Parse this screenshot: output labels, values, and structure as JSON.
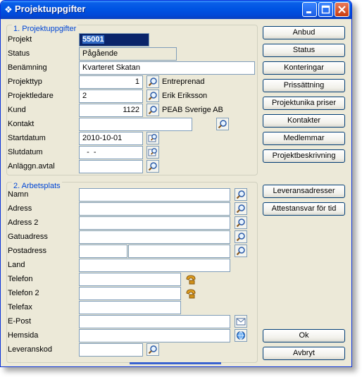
{
  "window": {
    "title": "Projektuppgifter"
  },
  "section1": {
    "title": "1. Projektuppgifter",
    "labels": {
      "projekt": "Projekt",
      "status": "Status",
      "benamning": "Benämning",
      "projekttyp": "Projekttyp",
      "projektledare": "Projektledare",
      "kund": "Kund",
      "kontakt": "Kontakt",
      "startdatum": "Startdatum",
      "slutdatum": "Slutdatum",
      "anlaggn": "Anläggn.avtal"
    },
    "values": {
      "projekt": "55001",
      "status": "Pågående",
      "benamning": "Kvarteret Skatan",
      "projekttyp": "1",
      "projekttyp_name": "Entreprenad",
      "projektledare": "2",
      "projektledare_name": "Erik Eriksson",
      "kund": "1122",
      "kund_name": "PEAB Sverige AB",
      "kontakt": "",
      "startdatum": "2010-10-01",
      "slutdatum": "  -  -",
      "anlaggn": ""
    }
  },
  "section2": {
    "title": "2. Arbetsplats",
    "labels": {
      "namn": "Namn",
      "adress": "Adress",
      "adress2": "Adress 2",
      "gatuadress": "Gatuadress",
      "postadress": "Postadress",
      "land": "Land",
      "telefon": "Telefon",
      "telefon2": "Telefon 2",
      "telefax": "Telefax",
      "epost": "E-Post",
      "hemsida": "Hemsida",
      "leveranskod": "Leveranskod"
    }
  },
  "buttons": {
    "anbud": "Anbud",
    "status": "Status",
    "konteringar": "Konteringar",
    "prissattning": "Prissättning",
    "projektunika": "Projektunika priser",
    "kontakter": "Kontakter",
    "medlemmar": "Medlemmar",
    "projektbeskrivning": "Projektbeskrivning",
    "leveransadresser": "Leveransadresser",
    "attestansvar": "Attestansvar för tid",
    "ok": "Ok",
    "avbryt": "Avbryt"
  }
}
